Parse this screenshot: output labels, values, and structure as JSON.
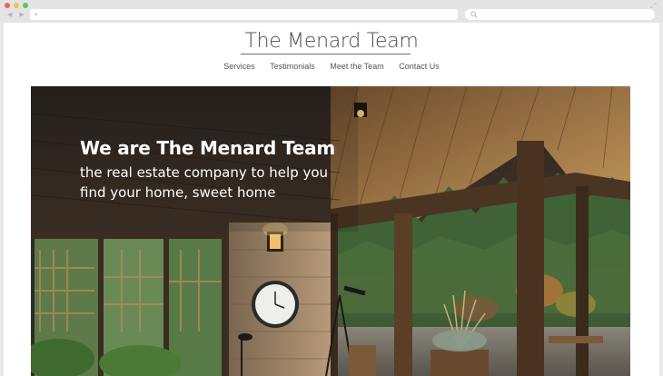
{
  "browser": {
    "nav_arrows": "◀ ▶",
    "url_plus": "+",
    "expand_glyph": "⤢"
  },
  "site": {
    "title": "The Menard Team"
  },
  "nav": {
    "items": [
      "Services",
      "Testimonials",
      "Meet the Team",
      "Contact Us"
    ]
  },
  "hero": {
    "heading": "We are The Menard Team",
    "subheading": "the real estate company to help you find your home, sweet home"
  },
  "colors": {
    "title_text": "#4a4a4a",
    "nav_text": "#555555",
    "hero_text": "#ffffff"
  }
}
